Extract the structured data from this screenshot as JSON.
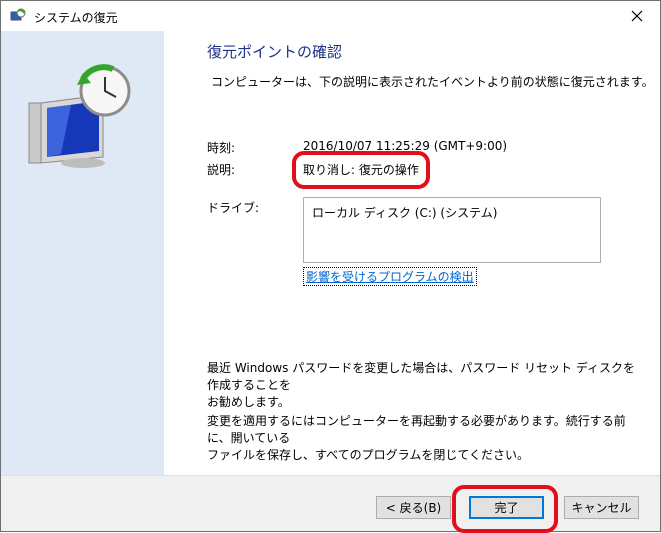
{
  "window": {
    "title": "システムの復元"
  },
  "main": {
    "heading": "復元ポイントの確認",
    "intro": "コンピューターは、下の説明に表示されたイベントより前の状態に復元されます。",
    "time_label": "時刻:",
    "time_value": "2016/10/07 11:25:29 (GMT+9:00)",
    "desc_label": "説明:",
    "desc_value": "取り消し: 復元の操作",
    "drive_label": "ドライブ:",
    "drives": [
      "ローカル ディスク (C:) (システム)"
    ],
    "scan_link": "影響を受けるプログラムの検出",
    "password_note_1": "最近 Windows パスワードを変更した場合は、パスワード リセット ディスクを作成することを",
    "password_note_2": "お勧めします。",
    "restart_note_1": "変更を適用するにはコンピューターを再起動する必要があります。続行する前に、開いている",
    "restart_note_2": "ファイルを保存し、すべてのプログラムを閉じてください。"
  },
  "buttons": {
    "back": "< 戻る(B)",
    "finish": "完了",
    "cancel": "キャンセル"
  },
  "icons": {
    "title": "system-restore-icon",
    "close": "close-icon",
    "panel": "monitor-clock-restore-icon"
  },
  "colors": {
    "heading": "#1e3287",
    "link": "#0066cc",
    "highlight": "#e20f1a",
    "side_panel": "#dfe9f5"
  }
}
